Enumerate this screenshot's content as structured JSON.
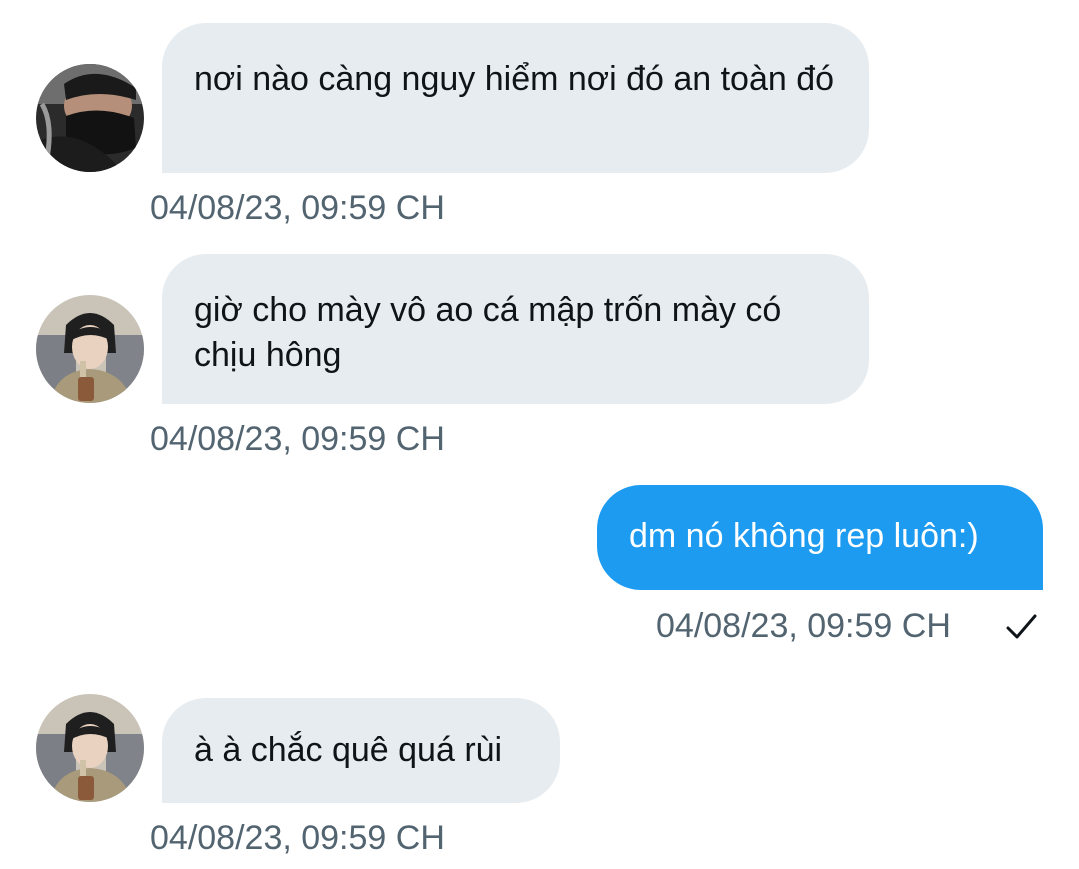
{
  "colors": {
    "incoming_bubble": "#e7ecf0",
    "outgoing_bubble": "#1d9bf0",
    "timestamp": "#536471",
    "text": "#0f1419"
  },
  "messages": [
    {
      "direction": "incoming",
      "avatar": "avatar-masked-person",
      "text": "nơi nào càng nguy hiểm nơi đó an toàn đó",
      "timestamp": "04/08/23, 09:59 CH"
    },
    {
      "direction": "incoming",
      "avatar": "avatar-person-with-drink",
      "text": "giờ cho mày vô ao cá mập trốn mày có chịu hông",
      "timestamp": "04/08/23, 09:59 CH"
    },
    {
      "direction": "outgoing",
      "text": "dm nó không rep luôn:)",
      "timestamp": "04/08/23, 09:59 CH",
      "status_icon": "checkmark-icon"
    },
    {
      "direction": "incoming",
      "avatar": "avatar-person-with-drink",
      "text": "à à chắc quê quá rùi",
      "timestamp": "04/08/23, 09:59 CH"
    }
  ]
}
